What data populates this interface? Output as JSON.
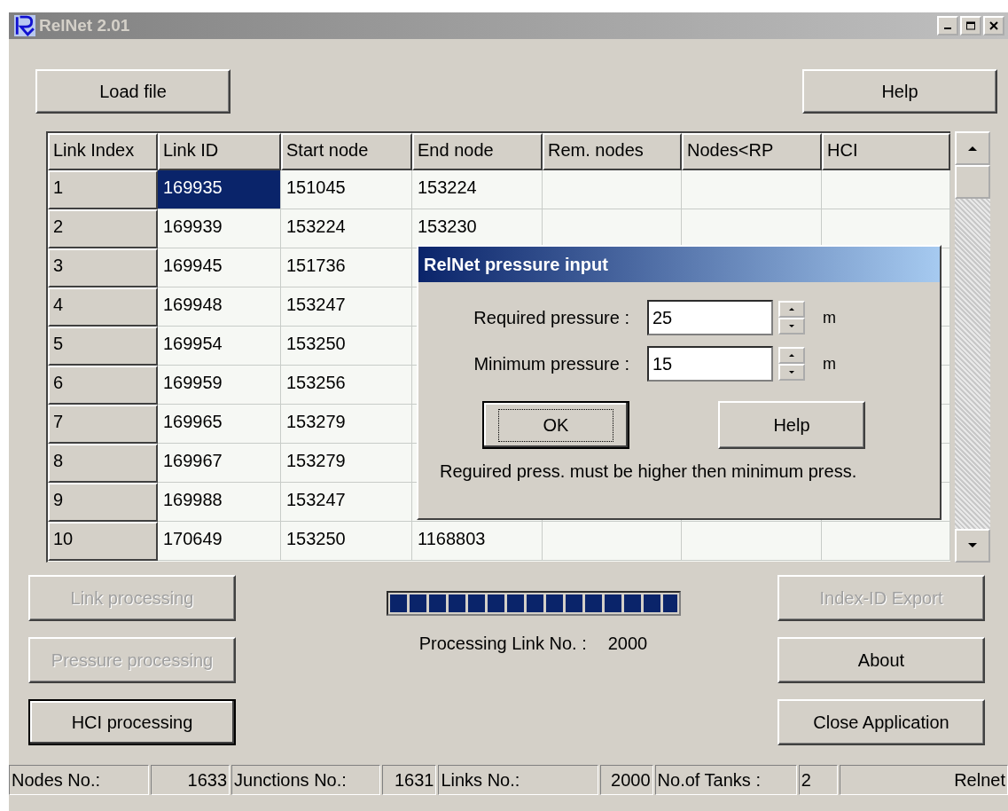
{
  "window": {
    "title": "RelNet 2.01"
  },
  "top_buttons": [
    {
      "label": "Load file"
    },
    {
      "label": "Help"
    }
  ],
  "table": {
    "columns": [
      "Link Index",
      "Link ID",
      "Start node",
      "End node",
      "Rem. nodes",
      "Nodes<RP",
      "HCI"
    ],
    "rows": [
      {
        "index": "1",
        "link_id": "169935",
        "start_node": "151045",
        "end_node": "153224",
        "selected": true
      },
      {
        "index": "2",
        "link_id": "169939",
        "start_node": "153224",
        "end_node": "153230",
        "selected": false
      },
      {
        "index": "3",
        "link_id": "169945",
        "start_node": "151736",
        "selected": false
      },
      {
        "index": "4",
        "link_id": "169948",
        "start_node": "153247",
        "selected": false
      },
      {
        "index": "5",
        "link_id": "169954",
        "start_node": "153250",
        "selected": false
      },
      {
        "index": "6",
        "link_id": "169959",
        "start_node": "153256",
        "selected": false
      },
      {
        "index": "7",
        "link_id": "169965",
        "start_node": "153279",
        "selected": false
      },
      {
        "index": "8",
        "link_id": "169967",
        "start_node": "153279",
        "selected": false
      },
      {
        "index": "9",
        "link_id": "169988",
        "start_node": "153247",
        "selected": false
      },
      {
        "index": "10",
        "link_id": "170649",
        "start_node": "153250",
        "end_node": "1168803",
        "selected": false
      }
    ]
  },
  "dialog": {
    "title": "RelNet pressure input",
    "fields": [
      {
        "label": "Required pressure :",
        "value": "25",
        "unit": "m"
      },
      {
        "label": "Minimum pressure :",
        "value": "15",
        "unit": "m"
      }
    ],
    "buttons": [
      {
        "label": "OK",
        "focused": true
      },
      {
        "label": "Help",
        "focused": false
      }
    ],
    "message": "Reguired press. must be higher then minimum press."
  },
  "left_buttons": [
    {
      "label": "Link processing",
      "disabled": true,
      "default": false
    },
    {
      "label": "Pressure processing",
      "disabled": true,
      "default": false
    },
    {
      "label": "HCI processing",
      "disabled": false,
      "default": true
    }
  ],
  "progress": {
    "level": 1,
    "label": "Processing Link No. :",
    "value": "2000"
  },
  "right_buttons": [
    {
      "label": "Index-ID Export",
      "disabled": true
    },
    {
      "label": "About",
      "disabled": false
    },
    {
      "label": "Close Application",
      "disabled": false
    }
  ],
  "status_bar": [
    "Nodes No.:",
    "1633",
    "Junctions No.:",
    "1631",
    "Links No.:",
    "2000",
    "No.of Tanks :",
    "2",
    "Relnet"
  ]
}
